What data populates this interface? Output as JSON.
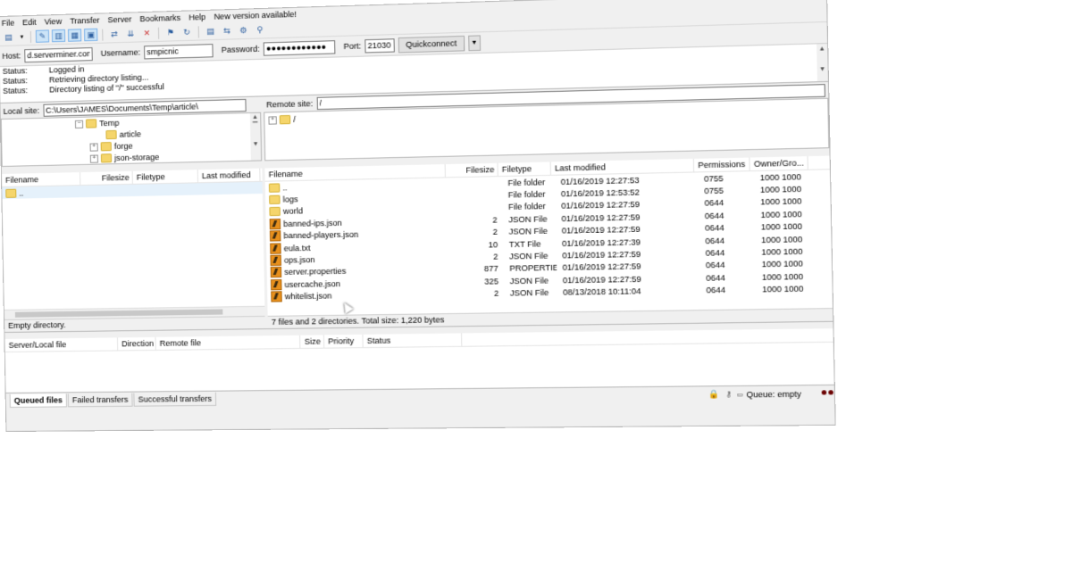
{
  "menu": {
    "items": [
      "File",
      "Edit",
      "View",
      "Transfer",
      "Server",
      "Bookmarks",
      "Help",
      "New version available!"
    ]
  },
  "toolbar": {
    "icons": [
      "site-manager-icon",
      "dropdown-arrow-icon",
      "toggle-log-icon",
      "toggle-local-tree-icon",
      "toggle-remote-tree-icon",
      "toggle-queue-icon",
      "refresh-icon",
      "process-queue-icon",
      "cancel-icon",
      "disconnect-icon",
      "reconnect-icon",
      "filter-icon",
      "compare-icon",
      "sync-browse-icon",
      "search-icon"
    ]
  },
  "quickconnect": {
    "host_label": "Host:",
    "host_value": "d.serverminer.com",
    "user_label": "Username:",
    "user_value": "smpicnic",
    "pass_label": "Password:",
    "pass_value": "●●●●●●●●●●●●",
    "port_label": "Port:",
    "port_value": "21030",
    "button_label": "Quickconnect"
  },
  "log": [
    {
      "label": "Status:",
      "text": "Logged in"
    },
    {
      "label": "Status:",
      "text": "Retrieving directory listing..."
    },
    {
      "label": "Status:",
      "text": "Directory listing of \"/\" successful"
    }
  ],
  "local": {
    "site_label": "Local site:",
    "path": "C:\\Users\\JAMES\\Documents\\Temp\\article\\",
    "tree": [
      "Temp",
      "article",
      "forge",
      "json-storage"
    ],
    "columns": [
      "Filename",
      "Filesize",
      "Filetype",
      "Last modified"
    ],
    "files": [
      ".."
    ],
    "status": "Empty directory."
  },
  "remote": {
    "site_label": "Remote site:",
    "path": "/",
    "tree_root": "/",
    "columns": [
      "Filename",
      "Filesize",
      "Filetype",
      "Last modified",
      "Permissions",
      "Owner/Gro..."
    ],
    "files": [
      {
        "name": "..",
        "size": "",
        "type": "File folder",
        "modified": "01/16/2019 12:27:53",
        "perm": "0755",
        "owner": "1000 1000",
        "kind": "folder"
      },
      {
        "name": "logs",
        "size": "",
        "type": "File folder",
        "modified": "01/16/2019 12:53:52",
        "perm": "0755",
        "owner": "1000 1000",
        "kind": "folder"
      },
      {
        "name": "world",
        "size": "",
        "type": "File folder",
        "modified": "01/16/2019 12:27:59",
        "perm": "0644",
        "owner": "1000 1000",
        "kind": "folder"
      },
      {
        "name": "banned-ips.json",
        "size": "2",
        "type": "JSON File",
        "modified": "01/16/2019 12:27:59",
        "perm": "0644",
        "owner": "1000 1000",
        "kind": "file"
      },
      {
        "name": "banned-players.json",
        "size": "2",
        "type": "JSON File",
        "modified": "01/16/2019 12:27:59",
        "perm": "0644",
        "owner": "1000 1000",
        "kind": "file"
      },
      {
        "name": "eula.txt",
        "size": "10",
        "type": "TXT File",
        "modified": "01/16/2019 12:27:39",
        "perm": "0644",
        "owner": "1000 1000",
        "kind": "file"
      },
      {
        "name": "ops.json",
        "size": "2",
        "type": "JSON File",
        "modified": "01/16/2019 12:27:59",
        "perm": "0644",
        "owner": "1000 1000",
        "kind": "file"
      },
      {
        "name": "server.properties",
        "size": "877",
        "type": "PROPERTIE...",
        "modified": "01/16/2019 12:27:59",
        "perm": "0644",
        "owner": "1000 1000",
        "kind": "file"
      },
      {
        "name": "usercache.json",
        "size": "325",
        "type": "JSON File",
        "modified": "01/16/2019 12:27:59",
        "perm": "0644",
        "owner": "1000 1000",
        "kind": "file"
      },
      {
        "name": "whitelist.json",
        "size": "2",
        "type": "JSON File",
        "modified": "08/13/2018 10:11:04",
        "perm": "0644",
        "owner": "1000 1000",
        "kind": "file"
      }
    ],
    "status": "7 files and 2 directories. Total size: 1,220 bytes"
  },
  "queue": {
    "columns": [
      "Server/Local file",
      "Direction",
      "Remote file",
      "Size",
      "Priority",
      "Status"
    ],
    "tabs": [
      "Queued files",
      "Failed transfers",
      "Successful transfers"
    ],
    "status": "Queue: empty"
  },
  "colors": {
    "folder": "#f5d56b",
    "file_icon": "#e8901c",
    "toolbar_active": "#cce4f7"
  }
}
